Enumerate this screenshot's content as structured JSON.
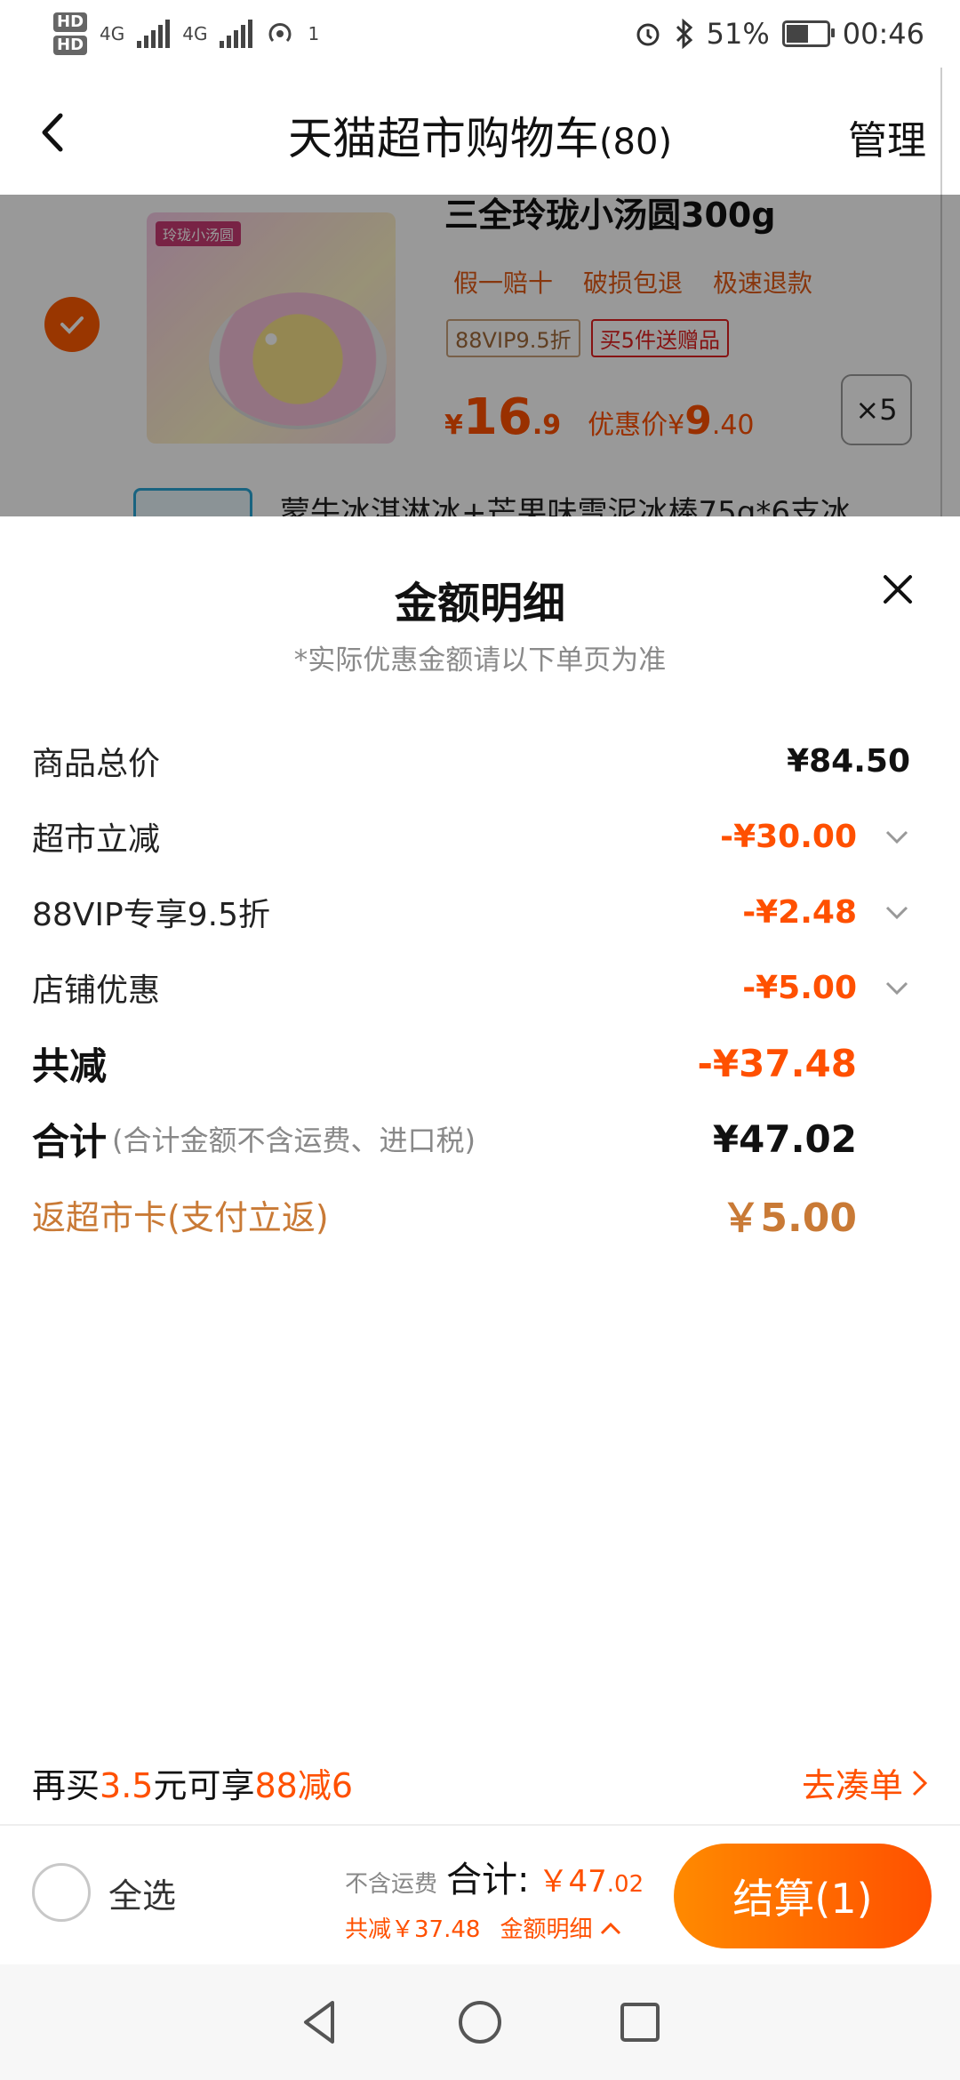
{
  "status_bar": {
    "hd1": "HD",
    "hd2": "HD",
    "net1": "4G",
    "net2": "4G",
    "hotspot_count": "1",
    "battery": "51%",
    "time": "00:46"
  },
  "header": {
    "title": "天猫超市购物车",
    "count": "(80)",
    "manage": "管理",
    "icons": [
      "back-arrow-icon"
    ]
  },
  "cart_item": {
    "name": "三全玲珑小汤圆300g",
    "image_label": "玲珑小汤圆",
    "tags": [
      "假一赔十",
      "破损包退",
      "极速退款"
    ],
    "badges": [
      "88VIP9.5折",
      "买5件送赠品"
    ],
    "price_symbol": "¥",
    "price_int": "16",
    "price_dec": ".9",
    "discount_label": "优惠价¥",
    "discount_int": "9",
    "discount_dec": ".40",
    "quantity": "×5",
    "next_item_name": "蒙牛冰淇淋冰+芒果味雪泥冰棒75g*6支冰"
  },
  "sheet": {
    "title": "金额明细",
    "subtitle": "*实际优惠金额请以下单页为准",
    "rows": [
      {
        "label": "商品总价",
        "value": "¥84.50"
      },
      {
        "label": "超市立减",
        "value": "-¥30.00"
      },
      {
        "label": "88VIP专享9.5折",
        "value": "-¥2.48"
      },
      {
        "label": "店铺优惠",
        "value": "-¥5.00"
      },
      {
        "label": "共减",
        "value": "-¥37.48"
      },
      {
        "label": "合计",
        "note": "(合计金额不含运费、进口税)",
        "value": "¥47.02"
      },
      {
        "label": "返超市卡(支付立返)",
        "value": "￥5.00"
      }
    ]
  },
  "promo": {
    "prefix": "再买",
    "amount": "3.5",
    "middle": "元可享",
    "offer": "88减6",
    "action": "去凑单"
  },
  "bottom_bar": {
    "select_all": "全选",
    "no_shipping": "不含运费",
    "total_label": "合计:",
    "total_symbol": "￥",
    "total_int": "47",
    "total_dec": ".02",
    "saved": "共减￥37.48",
    "detail": "金额明细",
    "checkout": "结算(1)"
  },
  "colors": {
    "accent": "#ff5000",
    "gold": "#c97a36"
  }
}
